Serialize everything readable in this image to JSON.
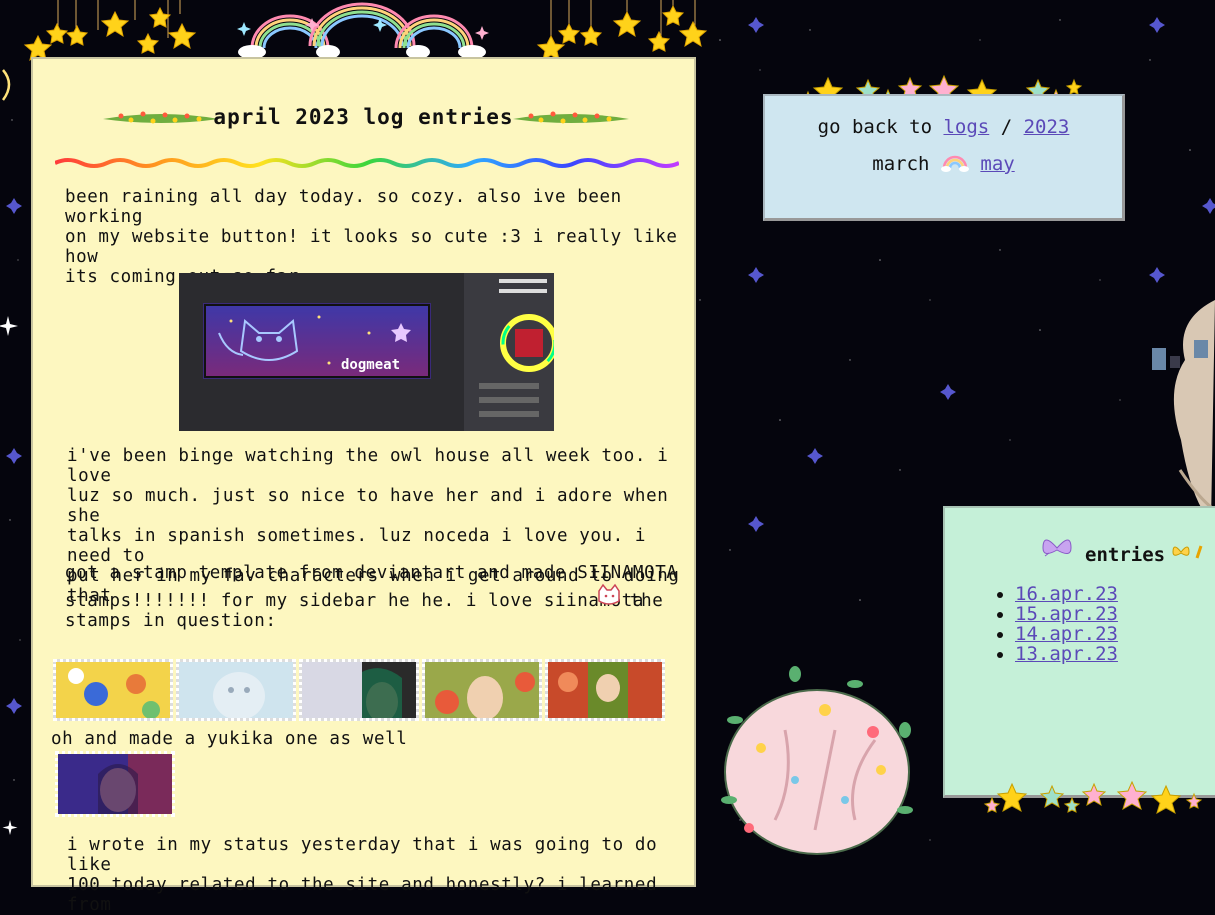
{
  "main": {
    "title": "april 2023 log entries",
    "paragraph1": "been raining all day today. so cozy. also ive been working\non my website button! it looks so cute :3 i really like how\nits coming out so far.",
    "button_text": "dogmeat",
    "paragraph2": "i've been binge watching the owl house all week too. i love\nluz so much. just so nice to have her and i adore when she\ntalks in spanish sometimes. luz noceda i love you. i need to\nput her in my fav characters when i get around to doing that",
    "paragraph3a": "got a stamp template from deviantart and made SIINAMOTA",
    "paragraph3b": "stamps!!!!!!! for my sidebar he he. i love siinamota",
    "paragraph3c": "the",
    "paragraph3d": "stamps in question:",
    "paragraph4": "oh and made a yukika one as well",
    "paragraph5": "i wrote in my status yesterday that i was going to do like\n100 today related to the site and honestly? i learned from"
  },
  "nav": {
    "go_back_prefix": "go back to",
    "logs_link": "logs",
    "separator": "/",
    "year_link": "2023",
    "prev_label": "march",
    "next_link": "may"
  },
  "entries": {
    "title": "entries",
    "items": [
      "16.apr.23",
      "15.apr.23",
      "14.apr.23",
      "13.apr.23"
    ]
  },
  "colors": {
    "page_bg": "#05050d",
    "main_panel_bg": "#fdf7c0",
    "nav_box_bg": "#cfe6f0",
    "entries_box_bg": "#c5f0d8",
    "link": "#5b49b8"
  }
}
